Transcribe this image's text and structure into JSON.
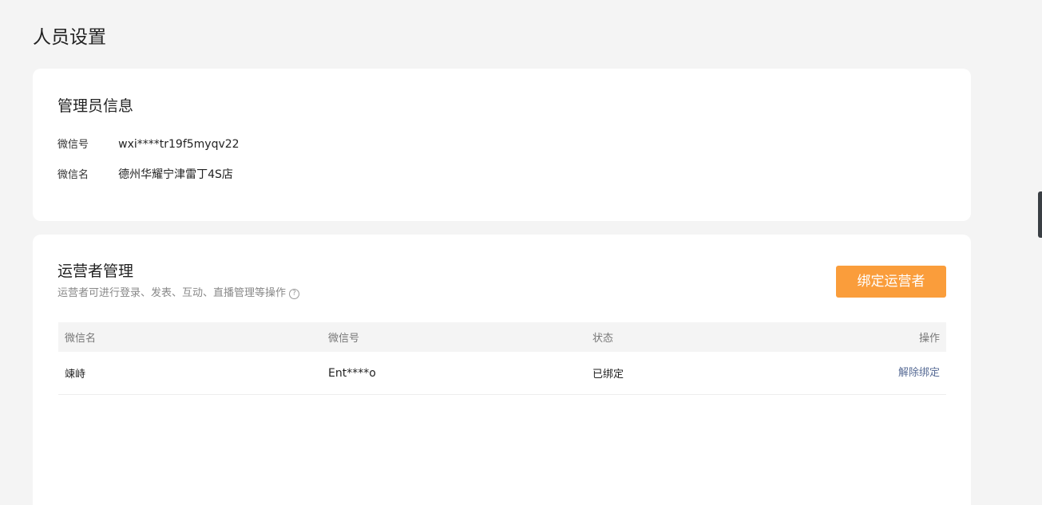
{
  "page": {
    "title": "人员设置"
  },
  "admin": {
    "title": "管理员信息",
    "wxid_label": "微信号",
    "wxid_value": "wxi****tr19f5myqv22",
    "wxname_label": "微信名",
    "wxname_value": "德州华耀宁津雷丁4S店"
  },
  "operators": {
    "title": "运营者管理",
    "description": "运营者可进行登录、发表、互动、直播管理等操作",
    "help_icon": "question-circle-icon",
    "bind_button_label": "绑定运营者",
    "columns": {
      "name": "微信名",
      "id": "微信号",
      "status": "状态",
      "action": "操作"
    },
    "rows": [
      {
        "name": "竦峙",
        "id": "Ent****o",
        "status": "已绑定",
        "action": "解除绑定"
      }
    ]
  },
  "colors": {
    "accent": "#fa9d3b",
    "link": "#576b95",
    "background": "#f4f4f4"
  }
}
